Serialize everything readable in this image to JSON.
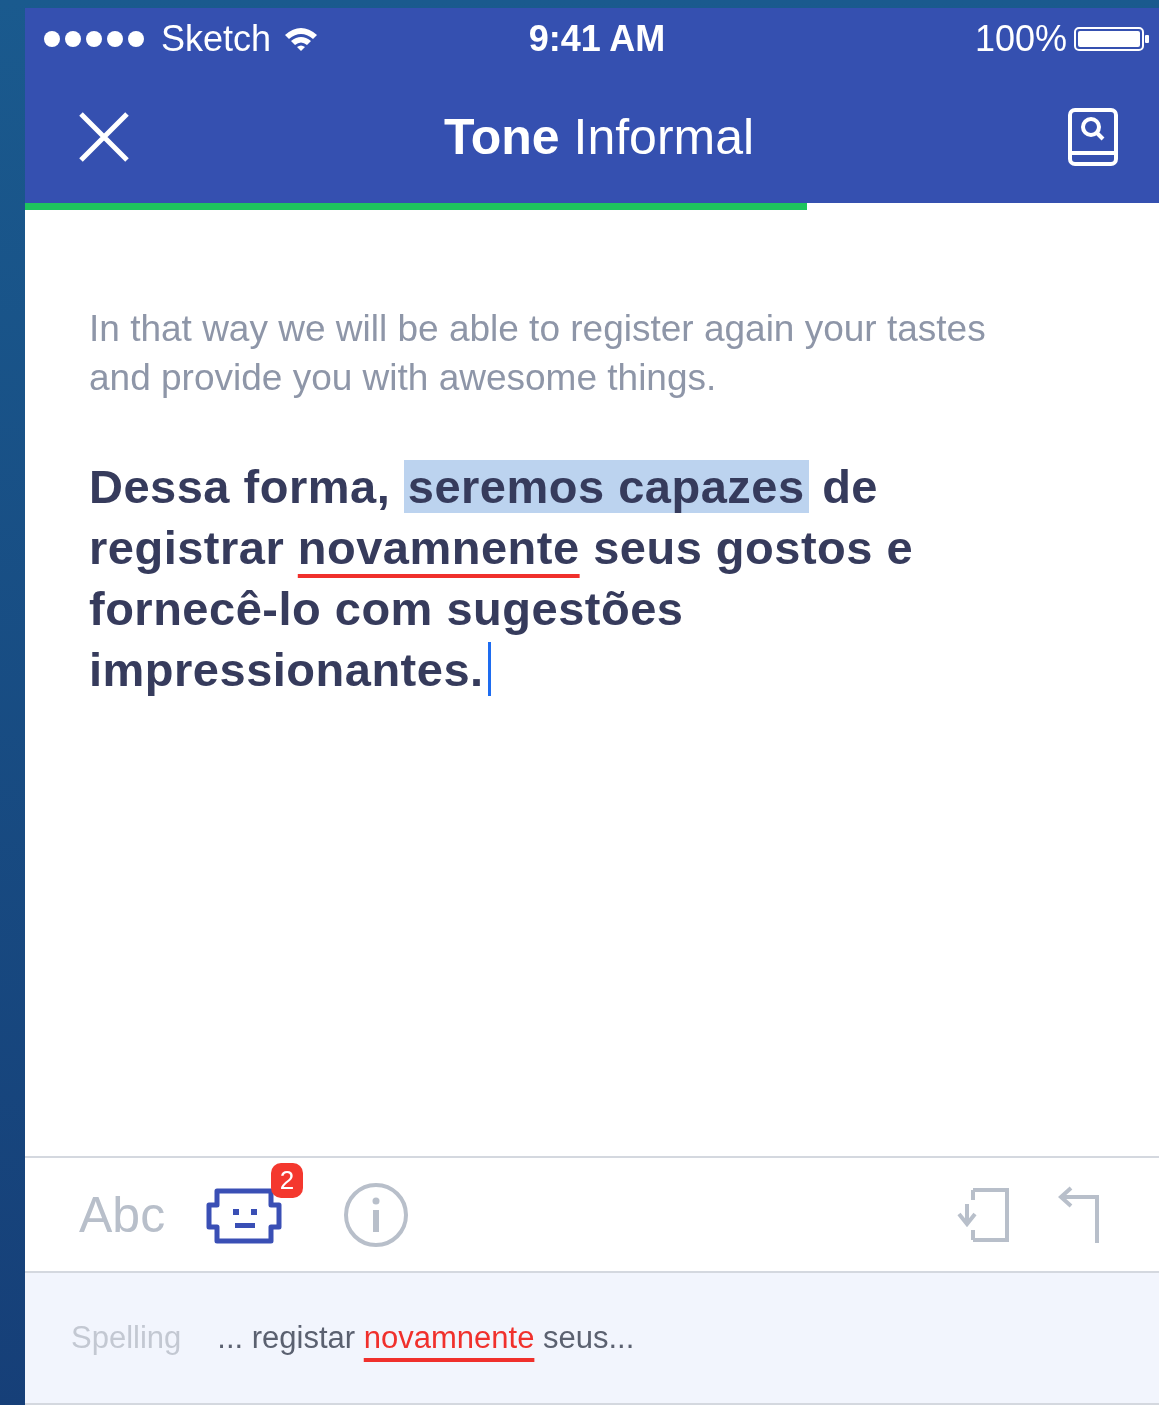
{
  "status_bar": {
    "carrier": "Sketch",
    "time": "9:41 AM",
    "battery": "100%"
  },
  "nav": {
    "title_bold": "Tone",
    "title": "Informal",
    "progress": {
      "level": 0.69
    }
  },
  "source_text": "In that way we will be able to register again your tastes and provide you with awesome things.",
  "translation": [
    {
      "kind": "plain",
      "text": "Dessa forma, "
    },
    {
      "kind": "highlight",
      "text": "seremos capazes"
    },
    {
      "kind": "plain",
      "text": " de registrar "
    },
    {
      "kind": "misspelled",
      "text": "novamnente"
    },
    {
      "kind": "plain",
      "text": " seus gostos e fornecê-lo com sugestões impressionantes."
    }
  ],
  "toolbar": {
    "tools": [
      {
        "kind": "text",
        "label": "Abc",
        "selected": false
      },
      {
        "kind": "robot",
        "badge": "2",
        "selected": true
      },
      {
        "kind": "info",
        "selected": false
      }
    ]
  },
  "suggestion": {
    "category": "Spelling",
    "before": "... registar",
    "word": "novamnente",
    "after": "seus..."
  }
}
